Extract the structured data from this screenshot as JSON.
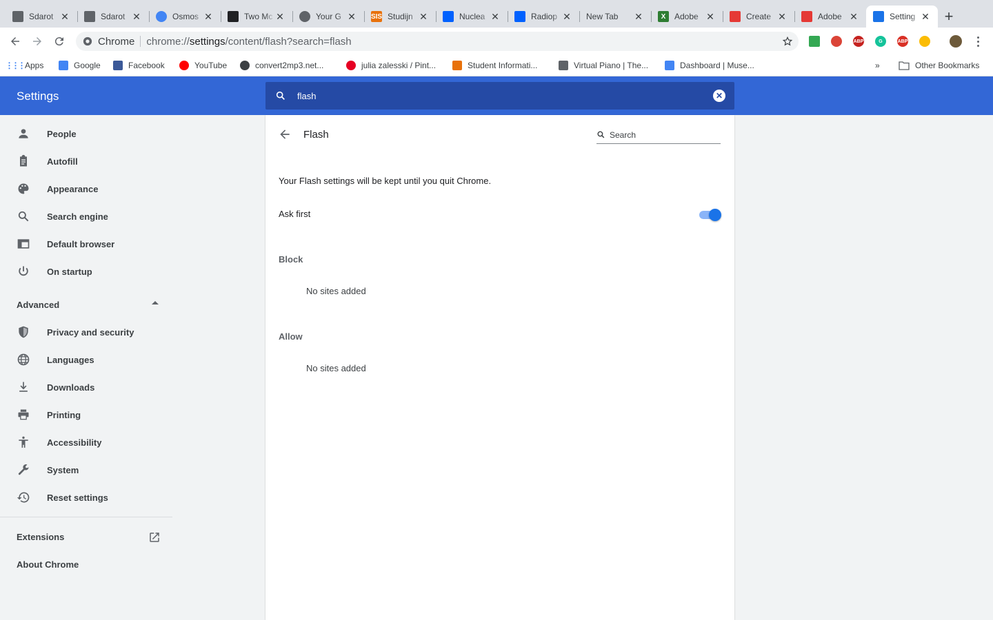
{
  "tabs": [
    {
      "title": "Sdarot",
      "color": "#5f6368",
      "glyph": ""
    },
    {
      "title": "Sdarot",
      "color": "#5f6368",
      "glyph": ""
    },
    {
      "title": "Osmos",
      "color": "#4285f4",
      "glyph": ""
    },
    {
      "title": "Two Mc",
      "color": "#202124",
      "glyph": ""
    },
    {
      "title": "Your G",
      "color": "#5f6368",
      "glyph": ""
    },
    {
      "title": "Studijn",
      "color": "#e8710a",
      "glyph": "SIS"
    },
    {
      "title": "Nuclea",
      "color": "#0061fe",
      "glyph": ""
    },
    {
      "title": "Radiop",
      "color": "#0061fe",
      "glyph": ""
    },
    {
      "title": "New Tab",
      "color": "",
      "glyph": ""
    },
    {
      "title": "Adobe",
      "color": "#2e7d32",
      "glyph": "X"
    },
    {
      "title": "Create",
      "color": "#e53935",
      "glyph": ""
    },
    {
      "title": "Adobe",
      "color": "#e53935",
      "glyph": ""
    },
    {
      "title": "Setting",
      "color": "#1a73e8",
      "glyph": ""
    }
  ],
  "omnibox": {
    "chip": "Chrome",
    "url_prefix": "chrome://",
    "url_host": "settings",
    "url_path": "/content/flash?search=flash"
  },
  "bookmarks": [
    {
      "label": "Apps",
      "icon": "apps-grid-icon",
      "color": "#4285f4"
    },
    {
      "label": "Google",
      "icon": "google-icon",
      "color": "#4285f4"
    },
    {
      "label": "Facebook",
      "icon": "facebook-icon",
      "color": "#3b5998"
    },
    {
      "label": "YouTube",
      "icon": "youtube-icon",
      "color": "#ff0000"
    },
    {
      "label": "convert2mp3.net...",
      "icon": "globe-icon",
      "color": "#3c4043"
    },
    {
      "label": "julia zalesski / Pint...",
      "icon": "pinterest-icon",
      "color": "#e60023"
    },
    {
      "label": "Student Informati...",
      "icon": "sis-icon",
      "color": "#e8710a"
    },
    {
      "label": "Virtual Piano | The...",
      "icon": "cube-icon",
      "color": "#5f6368"
    },
    {
      "label": "Dashboard | Muse...",
      "icon": "muse-icon",
      "color": "#4285f4"
    }
  ],
  "bookmarks_overflow": "»",
  "other_bookmarks": "Other Bookmarks",
  "settings": {
    "title": "Settings",
    "search_value": "flash"
  },
  "sidebar": {
    "items": [
      {
        "label": "People",
        "icon": "person-icon"
      },
      {
        "label": "Autofill",
        "icon": "clipboard-icon"
      },
      {
        "label": "Appearance",
        "icon": "palette-icon"
      },
      {
        "label": "Search engine",
        "icon": "search-icon"
      },
      {
        "label": "Default browser",
        "icon": "browser-window-icon"
      },
      {
        "label": "On startup",
        "icon": "power-icon"
      }
    ],
    "advanced_label": "Advanced",
    "advanced_items": [
      {
        "label": "Privacy and security",
        "icon": "shield-icon"
      },
      {
        "label": "Languages",
        "icon": "globe-icon"
      },
      {
        "label": "Downloads",
        "icon": "download-icon"
      },
      {
        "label": "Printing",
        "icon": "printer-icon"
      },
      {
        "label": "Accessibility",
        "icon": "accessibility-icon"
      },
      {
        "label": "System",
        "icon": "wrench-icon"
      },
      {
        "label": "Reset settings",
        "icon": "history-icon"
      }
    ],
    "extensions_label": "Extensions",
    "about_label": "About Chrome"
  },
  "flash": {
    "title": "Flash",
    "search_placeholder": "Search",
    "note": "Your Flash settings will be kept until you quit Chrome.",
    "ask_first_label": "Ask first",
    "ask_first_enabled": true,
    "block_label": "Block",
    "block_empty": "No sites added",
    "allow_label": "Allow",
    "allow_empty": "No sites added"
  },
  "colors": {
    "header_blue": "#3367d6",
    "search_blue": "#254aa5",
    "toggle_blue": "#1a73e8"
  }
}
